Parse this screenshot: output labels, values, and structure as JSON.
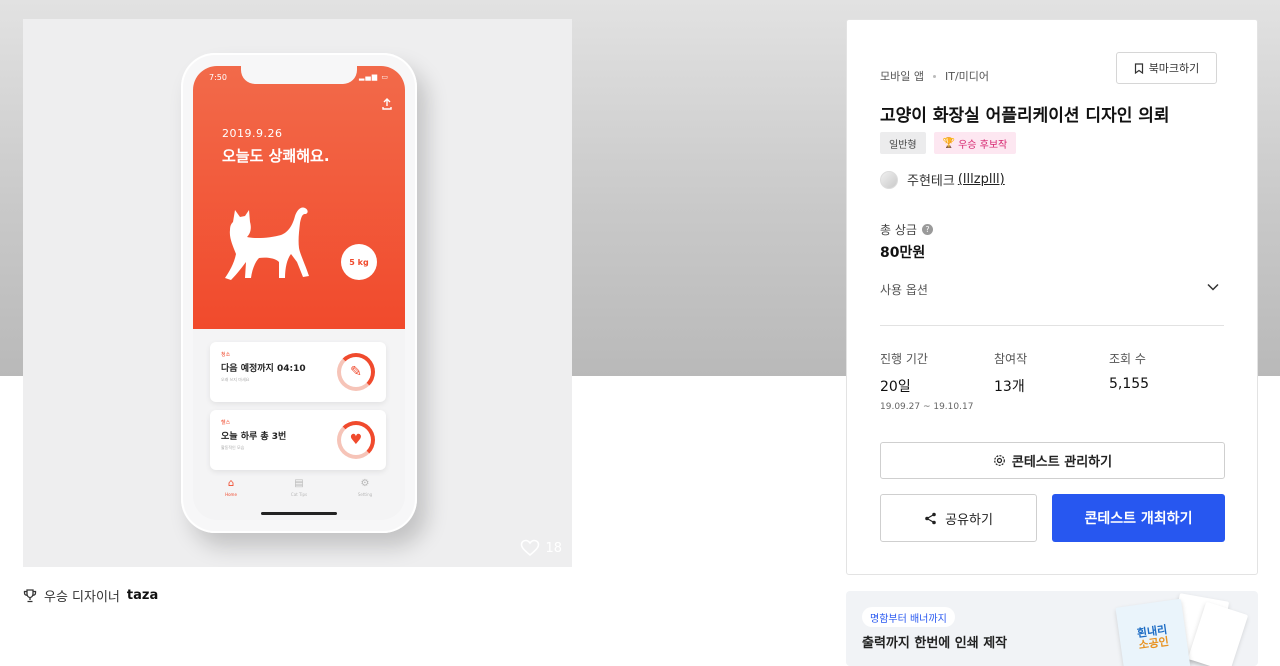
{
  "showcase": {
    "like_count": "18",
    "phone": {
      "status_time": "7:50",
      "date": "2019.9.26",
      "greeting": "오늘도 상쾌해요.",
      "weight": "5 kg",
      "cards": [
        {
          "tag": "청소",
          "title": "다음 예정까지 04:10",
          "sub": "오래 쓰지 마세요",
          "icon": "broom-icon"
        },
        {
          "tag": "헬스",
          "title": "오늘 하루 총 3번",
          "sub": "활동적인 모습",
          "icon": "heart-icon"
        }
      ],
      "tabs": [
        {
          "label": "Home",
          "icon": "home-icon",
          "active": true
        },
        {
          "label": "Cat Tips",
          "icon": "book-icon",
          "active": false
        },
        {
          "label": "Setting",
          "icon": "gear-icon",
          "active": false
        }
      ],
      "accent_color": "#f14a2c"
    }
  },
  "designer": {
    "label": "우승 디자이너",
    "name": "taza"
  },
  "panel": {
    "breadcrumb": [
      "모바일 앱",
      "IT/미디어"
    ],
    "bookmark_label": "북마크하기",
    "title": "고양이 화장실 어플리케이션 디자인 의뢰",
    "badges": {
      "type": "일반형",
      "award": "우승 후보작"
    },
    "host": {
      "name": "주현테크",
      "handle": "(lllzplll)"
    },
    "prize": {
      "label": "총 상금",
      "value": "80만원"
    },
    "usage_label": "사용 옵션",
    "stats": {
      "period": {
        "label": "진행 기간",
        "value": "20일",
        "dates": "19.09.27 ~ 19.10.17"
      },
      "entries": {
        "label": "참여작",
        "value": "13개"
      },
      "views": {
        "label": "조회 수",
        "value": "5,155"
      }
    },
    "manage_label": "콘테스트 관리하기",
    "share_label": "공유하기",
    "host_contest_label": "콘테스트 개최하기",
    "primary_color": "#2757f0"
  },
  "banner": {
    "pill": "명함부터 배너까지",
    "text": "출력까지 한번에 인쇄 제작",
    "art_lines": [
      "흰내리",
      "소공인"
    ]
  }
}
